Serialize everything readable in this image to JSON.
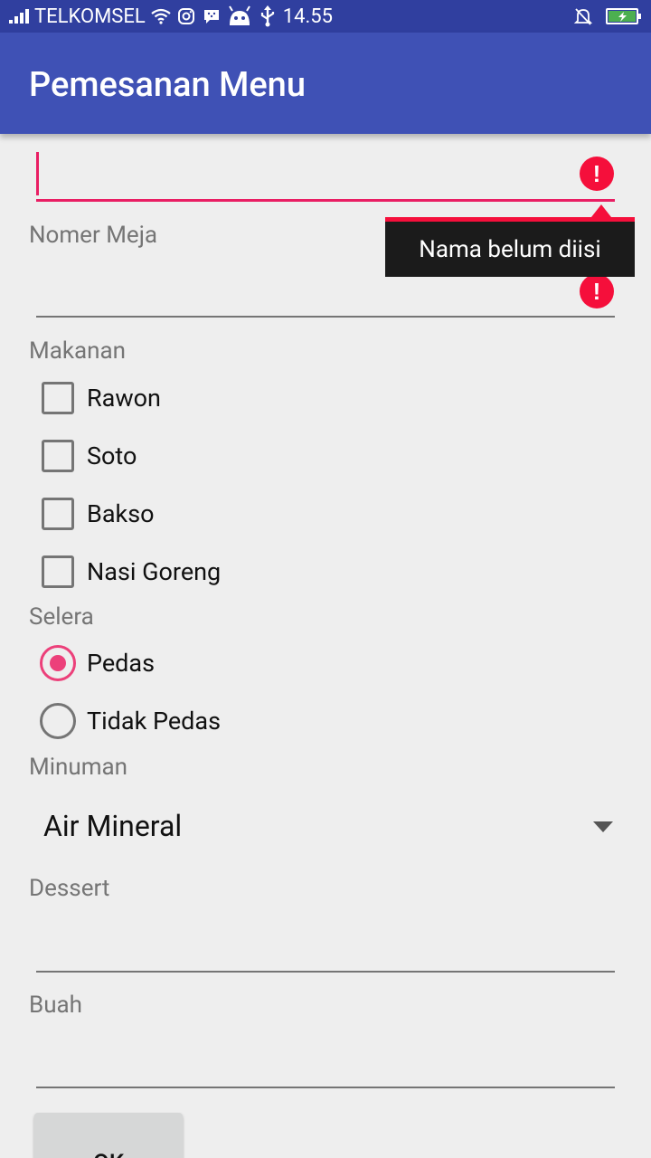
{
  "status_bar": {
    "carrier": "TELKOMSEL",
    "time": "14.55",
    "battery_color": "#4CAF50"
  },
  "app_bar": {
    "title": "Pemesanan Menu"
  },
  "nama_field": {
    "value": "",
    "error_tooltip": "Nama belum diisi"
  },
  "nomer_meja": {
    "placeholder": "Nomer Meja"
  },
  "makanan": {
    "label": "Makanan",
    "options": [
      {
        "label": "Rawon",
        "checked": false
      },
      {
        "label": "Soto",
        "checked": false
      },
      {
        "label": "Bakso",
        "checked": false
      },
      {
        "label": "Nasi Goreng",
        "checked": false
      }
    ]
  },
  "selera": {
    "label": "Selera",
    "options": [
      {
        "label": "Pedas",
        "selected": true
      },
      {
        "label": "Tidak Pedas",
        "selected": false
      }
    ]
  },
  "minuman": {
    "label": "Minuman",
    "selected": "Air Mineral"
  },
  "dessert": {
    "label": "Dessert"
  },
  "buah": {
    "label": "Buah"
  },
  "ok_button": {
    "label": "OK"
  },
  "colors": {
    "primary": "#3F51B5",
    "primary_dark": "#303F9F",
    "accent": "#EC407A",
    "error": "#F50F3B"
  }
}
